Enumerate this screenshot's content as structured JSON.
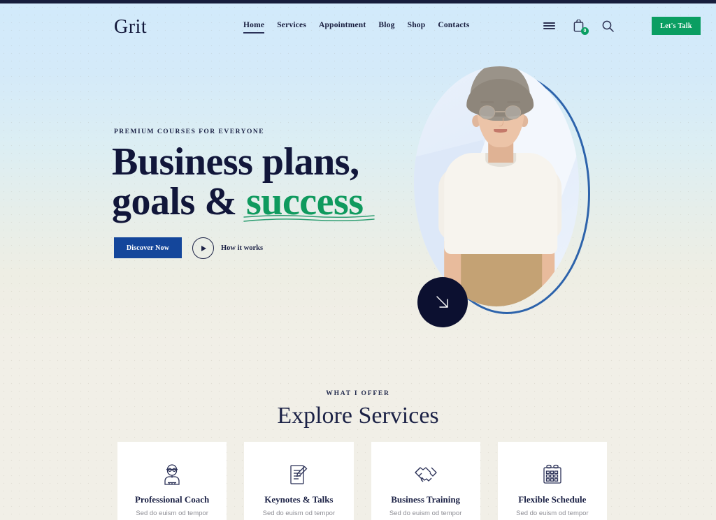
{
  "brand": {
    "logo": "Grit"
  },
  "nav": {
    "items": [
      {
        "label": "Home",
        "active": true
      },
      {
        "label": "Services",
        "active": false
      },
      {
        "label": "Appointment",
        "active": false
      },
      {
        "label": "Blog",
        "active": false
      },
      {
        "label": "Shop",
        "active": false
      },
      {
        "label": "Contacts",
        "active": false
      }
    ]
  },
  "header_icons": {
    "menu": "hamburger-menu-icon",
    "cart": "shopping-bag-icon",
    "cart_count": "0",
    "search": "search-icon"
  },
  "header_cta": {
    "label": "Let's Talk"
  },
  "hero": {
    "eyebrow": "PREMIUM COURSES FOR EVERYONE",
    "headline_line1": "Business plans,",
    "headline_line2_pre": "goals & ",
    "headline_line2_accent": "success",
    "primary_button": "Discover Now",
    "secondary_button": "How it works",
    "scroll_icon": "arrow-down-right-icon"
  },
  "offer": {
    "eyebrow": "WHAT I OFFER",
    "title": "Explore Services",
    "cards": [
      {
        "icon": "coach-person-icon",
        "title": "Professional Coach",
        "subtitle": "Sed do euism od tempor"
      },
      {
        "icon": "document-pen-icon",
        "title": "Keynotes & Talks",
        "subtitle": "Sed do euism od tempor"
      },
      {
        "icon": "handshake-icon",
        "title": "Business Training",
        "subtitle": "Sed do euism od tempor"
      },
      {
        "icon": "calendar-icon",
        "title": "Flexible Schedule",
        "subtitle": "Sed do euism od tempor"
      }
    ]
  },
  "colors": {
    "navy": "#171d3c",
    "accent_green": "#0a9e62",
    "accent_blue": "#14469b",
    "ring_blue": "#2d63ab",
    "bg_top": "#d2eafb",
    "bg_bottom": "#f1efe7",
    "text_dark": "#11163a"
  }
}
